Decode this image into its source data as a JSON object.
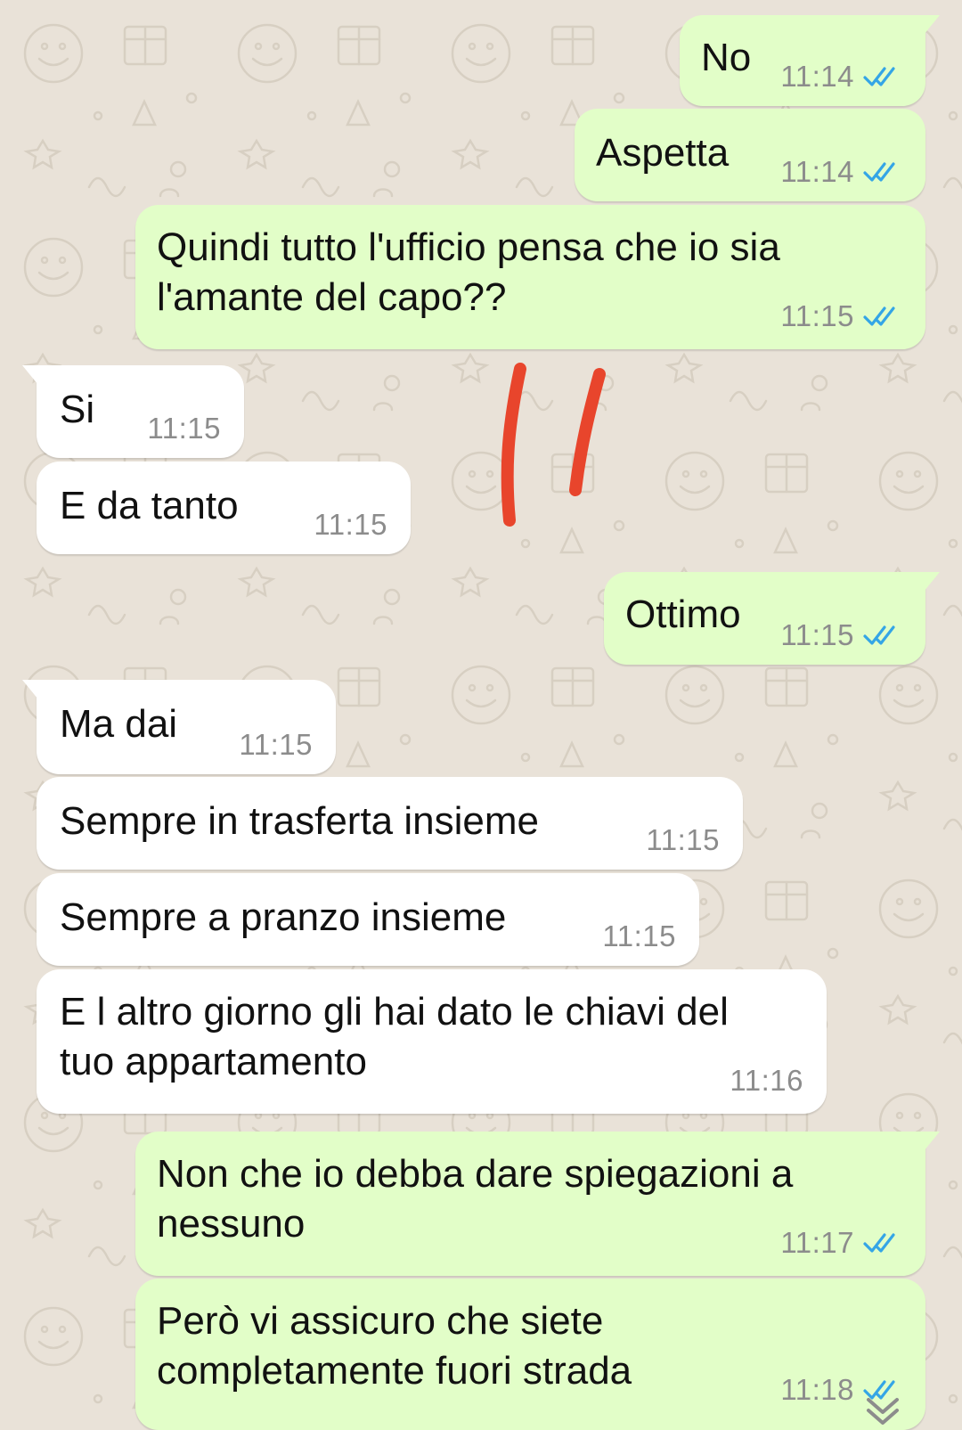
{
  "colors": {
    "background": "#e9e2d8",
    "outgoing_bubble": "#e2fec8",
    "incoming_bubble": "#ffffff",
    "timestamp": "#8c8c8c",
    "read_ticks": "#34a5e6",
    "annotation_marks": "#e8452c"
  },
  "messages": [
    {
      "direction": "out",
      "text": "No",
      "time": "11:14",
      "status": "read-ticks-icon",
      "tail": true
    },
    {
      "direction": "out",
      "text": "Aspetta",
      "time": "11:14",
      "status": "read-ticks-icon",
      "tail": false
    },
    {
      "direction": "out",
      "text": "Quindi tutto l'ufficio pensa che io sia\nl'amante del capo??",
      "time": "11:15",
      "status": "read-ticks-icon",
      "tail": false
    },
    {
      "direction": "in",
      "text": "Si",
      "time": "11:15",
      "tail": true
    },
    {
      "direction": "in",
      "text": "E da tanto",
      "time": "11:15",
      "tail": false
    },
    {
      "direction": "out",
      "text": "Ottimo",
      "time": "11:15",
      "status": "read-ticks-icon",
      "tail": true
    },
    {
      "direction": "in",
      "text": "Ma dai",
      "time": "11:15",
      "tail": true
    },
    {
      "direction": "in",
      "text": "Sempre in trasferta insieme",
      "time": "11:15",
      "tail": false
    },
    {
      "direction": "in",
      "text": "Sempre a pranzo insieme",
      "time": "11:15",
      "tail": false
    },
    {
      "direction": "in",
      "text": "E l altro giorno gli hai dato le chiavi del\ntuo appartamento",
      "time": "11:16",
      "tail": false
    },
    {
      "direction": "out",
      "text": "Non che io debba dare spiegazioni a\nnessuno",
      "time": "11:17",
      "status": "read-ticks-icon",
      "tail": true
    },
    {
      "direction": "out",
      "text": "Però vi assicuro che siete\ncompletamente fuori strada",
      "time": "11:18",
      "status": "read-ticks-icon",
      "tail": false
    }
  ],
  "annotation": {
    "type": "red-hand-drawn-marks"
  },
  "scroll_button": {
    "icon": "double-chevron-down-icon"
  }
}
